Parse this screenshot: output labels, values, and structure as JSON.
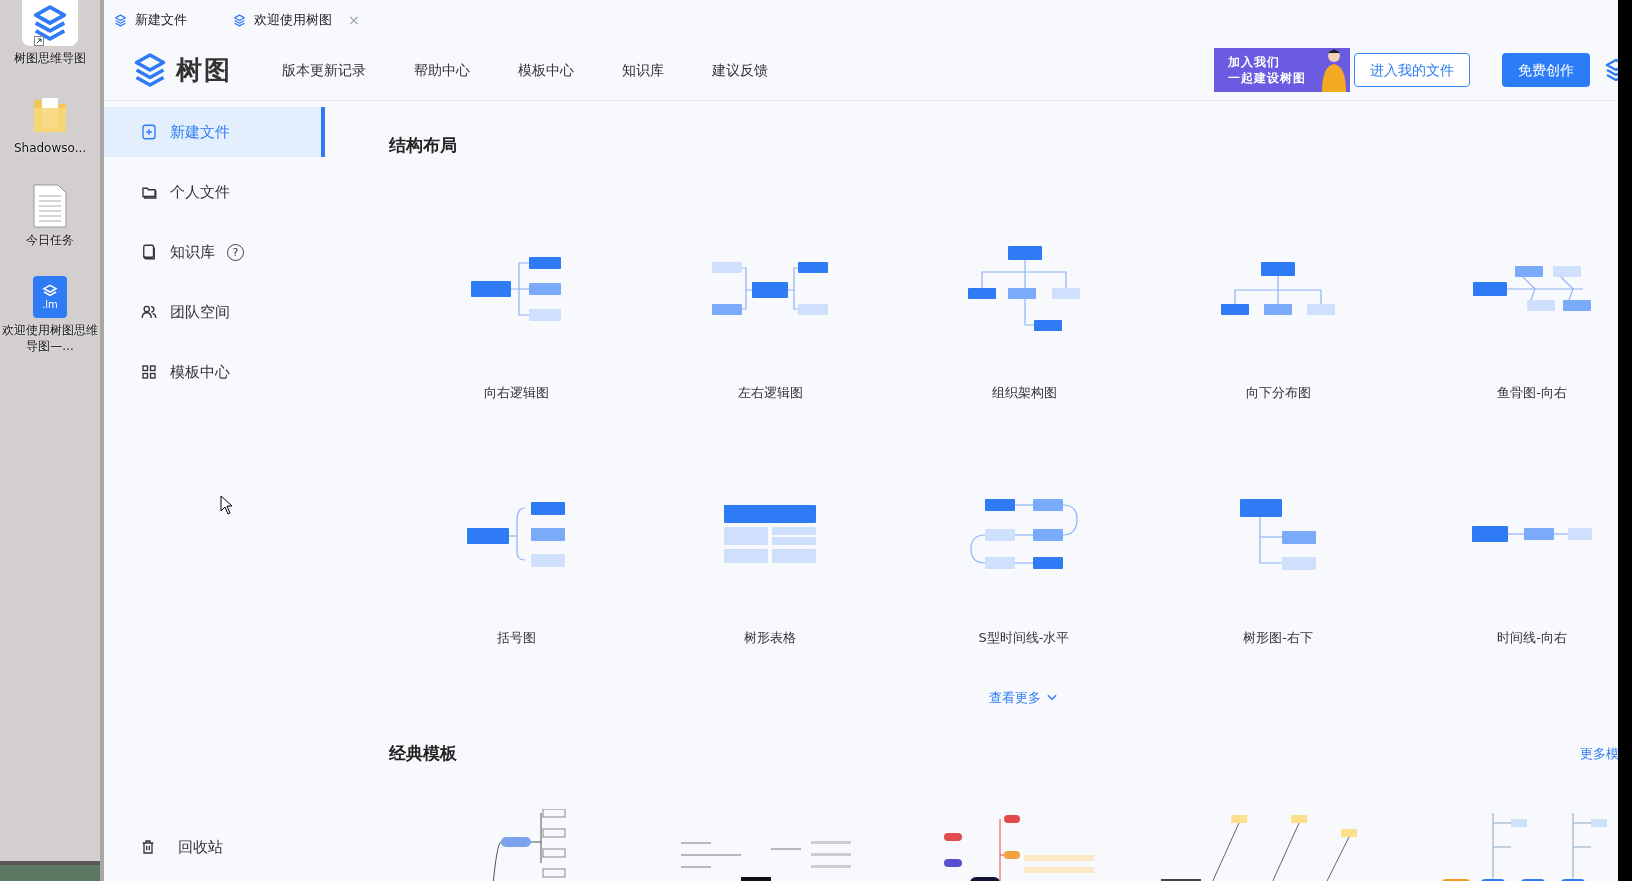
{
  "desktop": {
    "icons": [
      {
        "kind": "app",
        "label": "树图思维导图"
      },
      {
        "kind": "folder",
        "label": "Shadowso..."
      },
      {
        "kind": "document",
        "label": "今日任务"
      },
      {
        "kind": "file",
        "badge": ".lm",
        "label": "欢迎使用树图思维导图—..."
      }
    ]
  },
  "tabs": [
    {
      "label": "新建文件"
    },
    {
      "label": "欢迎使用树图",
      "close": "×"
    }
  ],
  "header": {
    "logo": "树图",
    "nav": [
      "版本更新记录",
      "帮助中心",
      "模板中心",
      "知识库",
      "建议反馈"
    ],
    "banner": [
      "加入我们",
      "一起建设树图"
    ],
    "buttons": [
      {
        "label": "进入我的文件",
        "kind": "outline"
      },
      {
        "label": "免费创作",
        "kind": "primary"
      }
    ]
  },
  "sidebar": {
    "items": [
      {
        "label": "新建文件",
        "selected": true
      },
      {
        "label": "个人文件",
        "selected": false
      },
      {
        "label": "知识库",
        "selected": false,
        "help": "?"
      },
      {
        "label": "团队空间",
        "selected": false
      },
      {
        "label": "模板中心",
        "selected": false
      }
    ],
    "trash": "回收站"
  },
  "structures": {
    "title": "结构布局",
    "items": [
      {
        "label": "向右逻辑图",
        "kind": "right-logic"
      },
      {
        "label": "左右逻辑图",
        "kind": "left-right"
      },
      {
        "label": "组织架构图",
        "kind": "org"
      },
      {
        "label": "向下分布图",
        "kind": "down"
      },
      {
        "label": "鱼骨图-向右",
        "kind": "fishbone"
      },
      {
        "label": "括号图",
        "kind": "bracket"
      },
      {
        "label": "树形表格",
        "kind": "table"
      },
      {
        "label": "S型时间线-水平",
        "kind": "s-timeline"
      },
      {
        "label": "树形图-右下",
        "kind": "tree"
      },
      {
        "label": "时间线-向右",
        "kind": "timeline"
      }
    ],
    "more": "查看更多"
  },
  "templates": {
    "title": "经典模板",
    "more": "更多模",
    "items": [
      {
        "kind": "mindmap"
      },
      {
        "kind": "logic"
      },
      {
        "kind": "colorful"
      },
      {
        "kind": "fishbone"
      },
      {
        "kind": "timeline"
      }
    ]
  }
}
